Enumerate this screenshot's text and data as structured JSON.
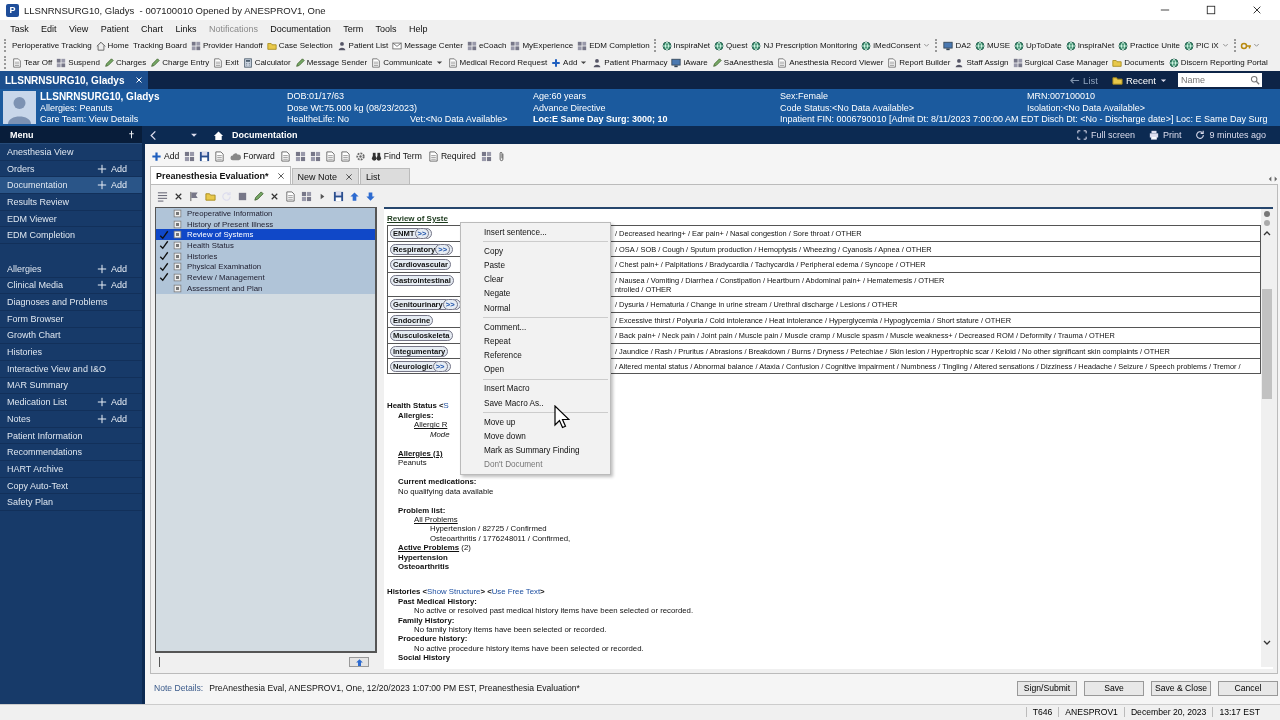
{
  "window": {
    "logo": "P",
    "title": "LLSNRNSURG10, Gladys  - 007100010 Opened by ANESPROV1, One"
  },
  "menu_bar": [
    {
      "label": "Task",
      "disabled": false
    },
    {
      "label": "Edit",
      "disabled": false
    },
    {
      "label": "View",
      "disabled": false
    },
    {
      "label": "Patient",
      "disabled": false
    },
    {
      "label": "Chart",
      "disabled": false
    },
    {
      "label": "Links",
      "disabled": false
    },
    {
      "label": "Notifications",
      "disabled": true
    },
    {
      "label": "Documentation",
      "disabled": false
    },
    {
      "label": "Term",
      "disabled": false
    },
    {
      "label": "Tools",
      "disabled": false
    },
    {
      "label": "Help",
      "disabled": false
    }
  ],
  "toolbars": [
    [
      [
        {
          "label": "Perioperative Tracking"
        },
        {
          "label": "Home"
        },
        {
          "label": "Tracking Board"
        },
        {
          "label": "Provider Handoff"
        },
        {
          "label": "Case Selection"
        },
        {
          "label": "Patient List"
        },
        {
          "label": "Message Center"
        },
        {
          "label": "eCoach"
        },
        {
          "label": "MyExperience"
        },
        {
          "label": "EDM Completion"
        }
      ],
      [
        {
          "label": "InspiraNet"
        },
        {
          "label": "Quest"
        },
        {
          "label": "NJ Prescription Monitoring"
        },
        {
          "label": "iMedConsent"
        }
      ],
      [
        {
          "label": "DA2"
        },
        {
          "label": "MUSE"
        },
        {
          "label": "UpToDate"
        },
        {
          "label": "InspiraNet"
        },
        {
          "label": "Practice Unite"
        },
        {
          "label": "PIC iX"
        }
      ]
    ],
    [
      [
        {
          "label": "Tear Off",
          "dropdown": false
        },
        {
          "label": "Suspend",
          "dropdown": false
        },
        {
          "label": "Charges",
          "dropdown": false
        },
        {
          "label": "Charge Entry",
          "dropdown": false
        },
        {
          "label": "Exit",
          "dropdown": false
        },
        {
          "label": "Calculator",
          "dropdown": false
        },
        {
          "label": "Message Sender",
          "dropdown": false
        },
        {
          "label": "Communicate",
          "dropdown": true
        },
        {
          "label": "Medical Record Request",
          "dropdown": false
        },
        {
          "label": "Add",
          "dropdown": true
        },
        {
          "label": "Patient Pharmacy",
          "dropdown": false
        },
        {
          "label": "iAware",
          "dropdown": false
        },
        {
          "label": "SaAnesthesia",
          "dropdown": false
        },
        {
          "label": "Anesthesia Record Viewer",
          "dropdown": false
        },
        {
          "label": "Report Builder",
          "dropdown": false
        },
        {
          "label": "Staff Assign",
          "dropdown": false
        },
        {
          "label": "Surgical Case Manager",
          "dropdown": false
        },
        {
          "label": "Documents",
          "dropdown": false
        },
        {
          "label": "Discern Reporting Portal",
          "dropdown": false
        }
      ]
    ]
  ],
  "patient_strip": {
    "tab": "LLSNRNSURG10, Gladys",
    "list": "List",
    "recent": "Recent",
    "search": {
      "placeholder": "Name"
    }
  },
  "banner": {
    "identity": [
      "LLSNRNSURG10, Gladys",
      "Allergies: Peanuts",
      "Care Team: View Details"
    ],
    "rows": [
      [
        "DOB:01/17/63",
        "Age:60 years",
        "Sex:Female",
        "MRN:007100010"
      ],
      [
        "Dose Wt:75.000 kg (08/23/2023)",
        "Advance Directive",
        "Code Status:<No Data Available>",
        "Isolation:<No Data Available>"
      ]
    ],
    "healthelife": "HealtheLife: No",
    "vet": "Vet:<No Data Available>",
    "location": "Loc:E Same Day Surg: 3000; 10",
    "encounter": "Inpatient FIN: 0006790010 [Admit Dt: 8/11/2023 7:00:00 AM EDT Disch Dt: <No - Discharge date>] Loc: E Same Day Surg"
  },
  "nav": {
    "menu_title": "Menu",
    "page_title": "Documentation",
    "actions": [
      "Full screen",
      "Print",
      "9 minutes ago"
    ]
  },
  "sidebar": [
    [
      {
        "label": "Anesthesia View",
        "selected": false
      },
      {
        "label": "Orders",
        "action": "Add",
        "selected": false
      },
      {
        "label": "Documentation",
        "action": "Add",
        "selected": true
      },
      {
        "label": "Results Review",
        "selected": false
      },
      {
        "label": "EDM Viewer",
        "selected": false
      },
      {
        "label": "EDM Completion",
        "selected": false
      }
    ],
    [
      {
        "label": "Allergies",
        "action": "Add",
        "selected": false
      },
      {
        "label": "Clinical Media",
        "action": "Add",
        "selected": false
      },
      {
        "label": "Diagnoses and Problems",
        "selected": false
      },
      {
        "label": "Form Browser",
        "selected": false
      },
      {
        "label": "Growth Chart",
        "selected": false
      },
      {
        "label": "Histories",
        "selected": false
      },
      {
        "label": "Interactive View and I&O",
        "selected": false
      },
      {
        "label": "MAR Summary",
        "selected": false
      },
      {
        "label": "Medication List",
        "action": "Add",
        "selected": false
      },
      {
        "label": "Notes",
        "action": "Add",
        "selected": false
      },
      {
        "label": "Patient Information",
        "selected": false
      },
      {
        "label": "Recommendations",
        "selected": false
      },
      {
        "label": "HART Archive",
        "selected": false
      },
      {
        "label": "Copy Auto-Text",
        "selected": false
      },
      {
        "label": "Safety Plan",
        "selected": false
      }
    ]
  ],
  "doc_toolbar": [
    "Add",
    "Forward",
    "Find Term",
    "Required"
  ],
  "doc_tabs": [
    {
      "label": "Preanesthesia Evaluation*",
      "selected": true,
      "closable": true
    },
    {
      "label": "New Note",
      "selected": false,
      "closable": true
    },
    {
      "label": "List",
      "selected": false,
      "closable": false
    }
  ],
  "outline": [
    {
      "label": "Preoperative Information",
      "checked": false,
      "selected": false
    },
    {
      "label": "History of Present Illness",
      "checked": false,
      "selected": false
    },
    {
      "label": "Review of Systems",
      "checked": true,
      "selected": true
    },
    {
      "label": "Health Status",
      "checked": true,
      "selected": false
    },
    {
      "label": "Histories",
      "checked": true,
      "selected": false
    },
    {
      "label": "Physical Examination",
      "checked": true,
      "selected": false
    },
    {
      "label": "Review / Management",
      "checked": true,
      "selected": false
    },
    {
      "label": "Assessment and Plan",
      "checked": false,
      "selected": false
    }
  ],
  "review_of_systems": {
    "title": "Review of Syste",
    "rows": [
      {
        "label": "ENMT",
        "more": ">>",
        "findings": [
          "/ Decreased hearing+ / Ear pain+ / Nasal congestion / Sore throat / OTHER"
        ]
      },
      {
        "label": "Respiratory",
        "more": ">>",
        "findings": [
          "/ OSA / SOB / Cough / Sputum production / Hemoptysis / Wheezing / Cyanosis / Apnea / OTHER"
        ]
      },
      {
        "label": "Cardiovascular",
        "findings": [
          "/ Chest pain+ / Palpitations / Bradycardia / Tachycardia / Peripheral edema / Syncope / OTHER"
        ]
      },
      {
        "label": "Gastrointestinal",
        "findings": [
          "/ Nausea / Vomiting / Diarrhea / Constipation / Heartburn / Abdominal pain+ / Hematemesis / OTHER",
          "ntrolled / OTHER"
        ]
      },
      {
        "label": "Genitourinary",
        "more": ">>",
        "findings": [
          "/ Dysuria / Hematuria / Change in urine stream / Urethral discharge / Lesions / OTHER"
        ]
      },
      {
        "label": "Endocrine",
        "findings": [
          "/ Excessive thirst / Polyuria / Cold intolerance / Heat intolerance / Hyperglycemia / Hypoglycemia / Short stature / OTHER"
        ]
      },
      {
        "label": "Musculoskeleta",
        "findings": [
          "/ Back pain+ / Neck pain / Joint pain / Muscle pain / Muscle cramp / Muscle spasm / Muscle weakness+ / Decreased ROM / Deformity / Trauma / OTHER"
        ]
      },
      {
        "label": "Integumentary",
        "findings": [
          "/ Jaundice / Rash / Pruritus / Abrasions / Breakdown / Burns / Dryness / Petechiae / Skin lesion / Hypertrophic scar / Keloid / No other significant skin complaints / OTHER"
        ]
      },
      {
        "label": "Neurologic",
        "more": ">>",
        "findings": [
          "/ Altered mental status / Abnormal balance / Ataxia / Confusion / Cognitive impairment / Numbness / Tingling / Altered sensations / Dizziness / Headache / Seizure / Speech problems / Tremor /"
        ]
      }
    ]
  },
  "sections": [
    {
      "heading": [
        {
          "kind": "bold",
          "text": "Health Status <"
        },
        {
          "kind": "link",
          "text": "S"
        }
      ],
      "groups": [
        [
          {
            "kind": "label",
            "text": "Allergies:",
            "children": [
              {
                "kind": "link",
                "text": "Allergic R",
                "children": [
                  {
                    "kind": "italic",
                    "text": "Mode"
                  }
                ]
              }
            ]
          }
        ],
        [
          {
            "kind": "label-link",
            "text": "Allergies (1)"
          },
          {
            "kind": "plain",
            "text": "Peanuts"
          }
        ],
        [
          {
            "kind": "label",
            "text": "Current medications:"
          },
          {
            "kind": "plain",
            "text": "No qualifying data available"
          }
        ],
        [
          {
            "kind": "label",
            "text": "Problem list:",
            "children": [
              {
                "kind": "link",
                "text": "All Problems",
                "children": [
                  {
                    "kind": "plain",
                    "text": "Hypertension / 82725 / Confirmed"
                  },
                  {
                    "kind": "plain",
                    "text": "Osteoarthritis / 1776248011 / Confirmed,"
                  }
                ]
              }
            ]
          },
          {
            "kind": "label-link",
            "text": "Active Problems",
            "count": "(2)"
          },
          {
            "kind": "bold",
            "text": "Hypertension"
          },
          {
            "kind": "bold",
            "text": "Osteoarthritis"
          }
        ]
      ]
    },
    {
      "heading": [
        {
          "kind": "bold",
          "text": "Histories <"
        },
        {
          "kind": "link",
          "text": "Show Structure"
        },
        {
          "kind": "bold",
          "text": "> <"
        },
        {
          "kind": "link",
          "text": "Use Free Text"
        },
        {
          "kind": "bold",
          "text": ">"
        }
      ],
      "groups": [
        [
          {
            "kind": "label",
            "text": "Past Medical History:",
            "children": [
              {
                "kind": "plain",
                "text": "No active or resolved past medical history items have been selected or recorded."
              }
            ]
          },
          {
            "kind": "label",
            "text": "Family History:",
            "children": [
              {
                "kind": "plain",
                "text": "No family history items have been selected or recorded."
              }
            ]
          },
          {
            "kind": "label",
            "text": "Procedure history:",
            "children": [
              {
                "kind": "plain",
                "text": "No active procedure history items have been selected or recorded."
              }
            ]
          },
          {
            "kind": "label",
            "text": "Social History"
          }
        ]
      ]
    }
  ],
  "context_menu": [
    [
      {
        "label": "Insert sentence...",
        "disabled": false
      }
    ],
    [
      {
        "label": "Copy",
        "disabled": false
      },
      {
        "label": "Paste",
        "disabled": false
      },
      {
        "label": "Clear",
        "disabled": false
      },
      {
        "label": "Negate",
        "disabled": false
      },
      {
        "label": "Normal",
        "disabled": false
      }
    ],
    [
      {
        "label": "Comment...",
        "disabled": false
      },
      {
        "label": "Repeat",
        "disabled": false
      },
      {
        "label": "Reference",
        "disabled": false
      },
      {
        "label": "Open",
        "disabled": false
      }
    ],
    [
      {
        "label": "Insert Macro",
        "disabled": false
      },
      {
        "label": "Save Macro As..",
        "disabled": false
      }
    ],
    [
      {
        "label": "Move up",
        "disabled": false
      },
      {
        "label": "Move down",
        "disabled": false
      },
      {
        "label": "Mark as Summary Finding",
        "disabled": false
      },
      {
        "label": "Don't Document",
        "disabled": true
      }
    ]
  ],
  "note_details": {
    "label": "Note Details:",
    "value": "PreAnesthesia Eval, ANESPROV1, One, 12/20/2023 1:07:00 PM EST, Preanesthesia Evaluation*"
  },
  "buttons": [
    "Sign/Submit",
    "Save",
    "Save & Close",
    "Cancel"
  ],
  "status_bar": [
    "T646",
    "ANESPROV1",
    "December 20, 2023",
    "13:17 EST"
  ]
}
